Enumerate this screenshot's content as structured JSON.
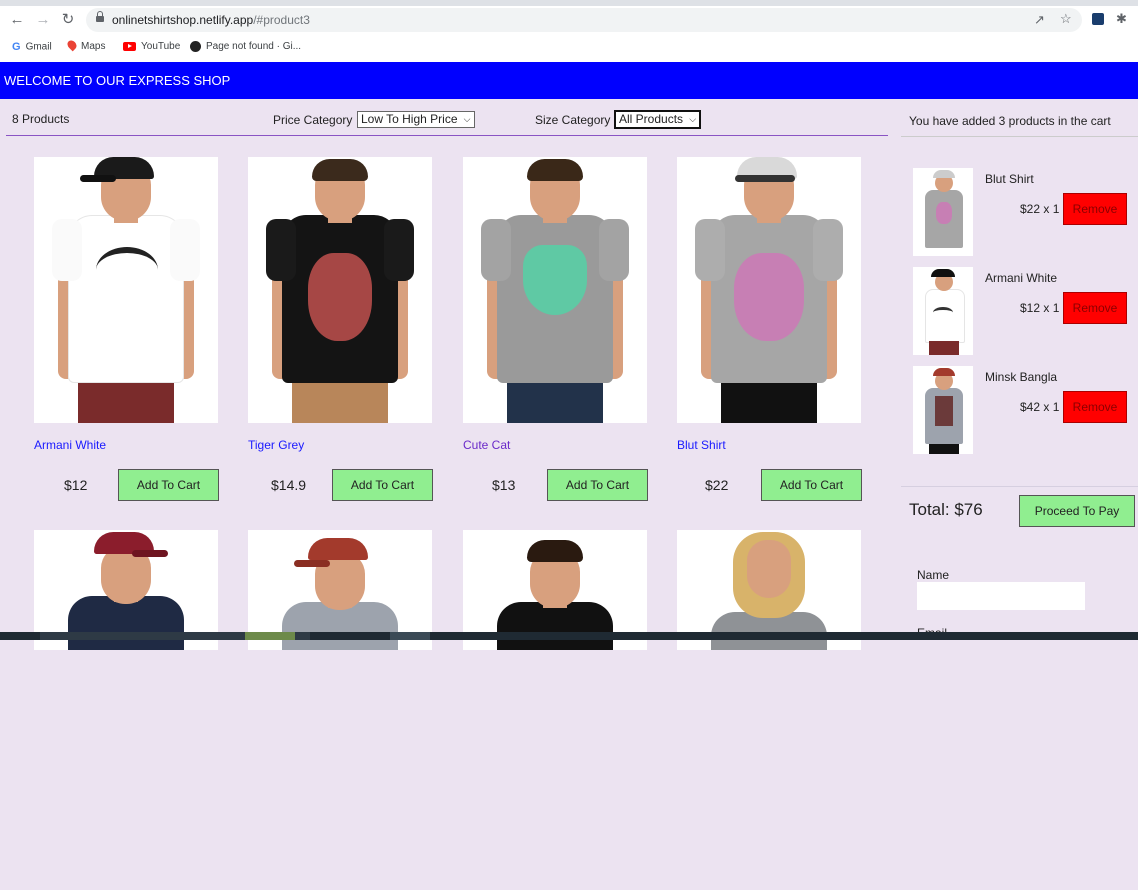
{
  "browser": {
    "url_host": "onlinetshirtshop.netlify.app",
    "url_path": "/#product3",
    "icons": [
      "back-icon",
      "forward-icon",
      "reload-icon",
      "lock-icon",
      "share-icon",
      "star-icon",
      "extension-icon",
      "puzzle-icon"
    ],
    "bookmarks": [
      {
        "label": "Gmail",
        "icon": "google-icon"
      },
      {
        "label": "Maps",
        "icon": "maps-icon"
      },
      {
        "label": "YouTube",
        "icon": "youtube-icon"
      },
      {
        "label": "Page not found · Gi...",
        "icon": "github-icon"
      }
    ]
  },
  "header": {
    "title": "WELCOME TO OUR EXPRESS SHOP",
    "bg": "#0000ff"
  },
  "filters": {
    "count": "8 Products",
    "price_label": "Price Category",
    "price_selected": "Low To High Price",
    "size_label": "Size Category",
    "size_selected": "All Products"
  },
  "products": [
    {
      "name": "Armani White",
      "price": "$12",
      "button": "Add To Cart"
    },
    {
      "name": "Tiger Grey",
      "price": "$14.9",
      "button": "Add To Cart"
    },
    {
      "name": "Cute Cat",
      "price": "$13",
      "button": "Add To Cart"
    },
    {
      "name": "Blut Shirt",
      "price": "$22",
      "button": "Add To Cart"
    }
  ],
  "cart": {
    "message": "You have added 3 products in the cart",
    "items": [
      {
        "name": "Blut Shirt",
        "qty": "$22 x 1",
        "button": "Remove"
      },
      {
        "name": "Armani White",
        "qty": "$12 x 1",
        "button": "Remove"
      },
      {
        "name": "Minsk Bangla",
        "qty": "$42 x 1",
        "button": "Remove"
      }
    ],
    "total": "Total: $76",
    "pay_button": "Proceed To Pay",
    "name_label": "Name",
    "email_label": "Email"
  },
  "colors": {
    "page_bg": "#ece3f1",
    "add_button": "#90ee90",
    "remove_button": "#ff0000",
    "link": "#1a1aff"
  }
}
